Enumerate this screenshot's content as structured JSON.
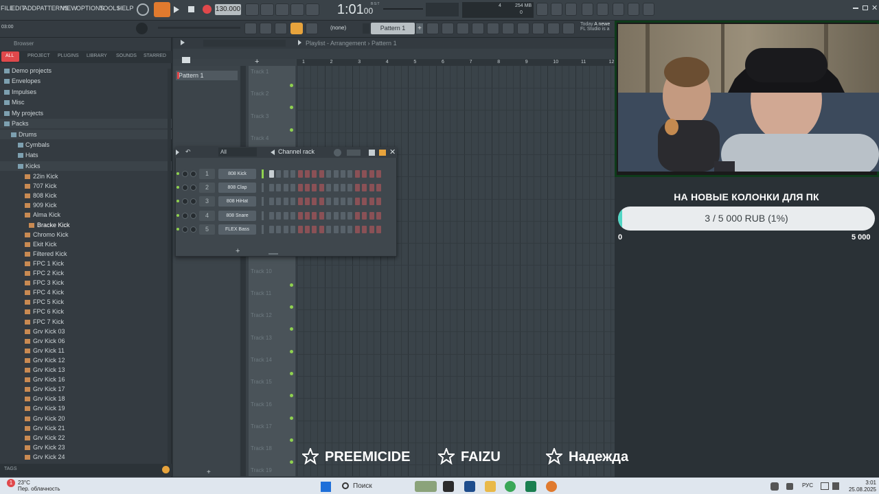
{
  "menu": [
    "FILE",
    "EDIT",
    "ADD",
    "PATTERNS",
    "VIEW",
    "OPTIONS",
    "TOOLS",
    "HELP"
  ],
  "transport": {
    "tempo": "130.000",
    "time": "1:01",
    "time_sub": "00",
    "time_small": "B:S:T",
    "cpu_mem": "254 MB",
    "cpu_num": "4",
    "cpu_zero": "0",
    "hint_time": "03:00"
  },
  "toolbar2": {
    "snap": "(none)",
    "pattern": "Pattern 1",
    "hint_today": "Today",
    "hint_news": "A newe",
    "hint_fl": "FL Studio is a"
  },
  "browser": {
    "title": "Browser",
    "tabs": [
      "ALL",
      "PROJECT",
      "PLUGINS",
      "LIBRARY",
      "SOUNDS",
      "STARRED"
    ],
    "folders": [
      "Demo projects",
      "Envelopes",
      "Impulses",
      "Misc",
      "My projects",
      "Packs",
      "Drums",
      "Cymbals",
      "Hats",
      "Kicks"
    ],
    "files": [
      "22in Kick",
      "707 Kick",
      "808 Kick",
      "909 Kick",
      "Alma Kick",
      "Bracke Kick",
      "Chromo Kick",
      "Ekit Kick",
      "Filtered Kick",
      "FPC 1 Kick",
      "FPC 2 Kick",
      "FPC 3 Kick",
      "FPC 4 Kick",
      "FPC 5 Kick",
      "FPC 6 Kick",
      "FPC 7 Kick",
      "Grv Kick 03",
      "Grv Kick 06",
      "Grv Kick 11",
      "Grv Kick 12",
      "Grv Kick 13",
      "Grv Kick 16",
      "Grv Kick 17",
      "Grv Kick 18",
      "Grv Kick 19",
      "Grv Kick 20",
      "Grv Kick 21",
      "Grv Kick 22",
      "Grv Kick 23",
      "Grv Kick 24"
    ],
    "tags": "TAGS"
  },
  "playlist": {
    "title": "Playlist - Arrangement",
    "pattern_crumb": "Pattern 1",
    "pattern_item": "Pattern 1",
    "ruler": [
      "1",
      "2",
      "3",
      "4",
      "5",
      "6",
      "7",
      "8",
      "9",
      "10",
      "11",
      "12"
    ],
    "tracks": [
      "Track 1",
      "Track 2",
      "Track 3",
      "Track 4",
      "Track 10",
      "Track 11",
      "Track 12",
      "Track 13",
      "Track 14",
      "Track 15",
      "Track 16",
      "Track 17",
      "Track 18",
      "Track 19"
    ]
  },
  "channel_rack": {
    "title": "Channel rack",
    "filter": "All",
    "channels": [
      {
        "num": "1",
        "name": "808 Kick"
      },
      {
        "num": "2",
        "name": "808 Clap"
      },
      {
        "num": "3",
        "name": "808 HiHat"
      },
      {
        "num": "4",
        "name": "808 Snare"
      },
      {
        "num": "5",
        "name": "FLEX Bass"
      }
    ],
    "first_step_on": true
  },
  "donation": {
    "title": "НА НОВЫЕ КОЛОНКИ ДЛЯ ПК",
    "progress_text": "3 / 5 000 RUB (1%)",
    "progress": 0.01,
    "min_label": "0",
    "max_label": "5 000"
  },
  "sponsors": [
    "PREEMICIDE",
    "FAIZU",
    "Надежда"
  ],
  "taskbar": {
    "weather_temp": "23°C",
    "weather_desc": "Пер. облачность",
    "search": "Поиск",
    "lang": "РУС",
    "time": "3:01",
    "date": "25.08.2025",
    "badge": "1"
  },
  "colors": {
    "accent_green": "#8fd14f",
    "donation_fill": "#51d6c4",
    "cam_border": "#0e3b1a",
    "step_red": "#8a5156"
  }
}
